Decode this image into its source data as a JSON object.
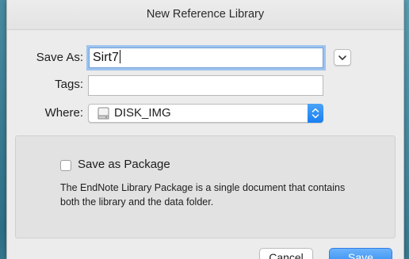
{
  "window": {
    "title": "New Reference Library"
  },
  "form": {
    "save_as_label": "Save As:",
    "save_as_value": "Sirt7",
    "tags_label": "Tags:",
    "tags_value": "",
    "where_label": "Where:",
    "where_value": "DISK_IMG",
    "where_icon": "disk-icon"
  },
  "options": {
    "package_checkbox_label": "Save as Package",
    "package_checked": false,
    "package_description": "The EndNote Library Package is a single document that contains both the library and the data folder."
  },
  "buttons": {
    "cancel_label": "Cancel",
    "save_label": "Save"
  },
  "colors": {
    "accent": "#2f8bf3",
    "focus_ring": "#9ec3ee",
    "sheet_background": "#ececec",
    "panel_background": "#e2e2e2"
  }
}
